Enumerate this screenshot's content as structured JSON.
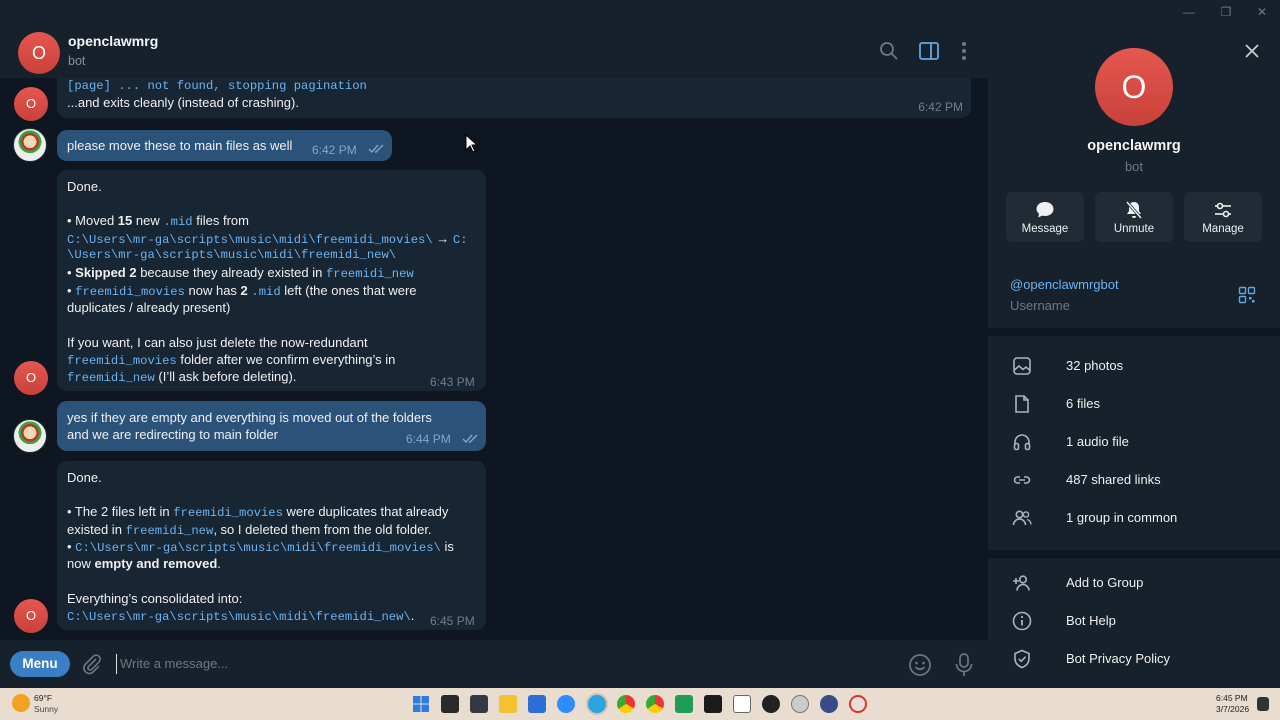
{
  "window": {
    "minimize": "—",
    "maximize": "❐",
    "close": "✕"
  },
  "header": {
    "avatar_letter": "O",
    "name": "openclawmrg",
    "status": "bot"
  },
  "messages": {
    "m1": {
      "line1": "[page] ... not found, stopping pagination",
      "line2": "...and exits cleanly (instead of crashing).",
      "time": "6:42 PM",
      "avatar": "O"
    },
    "m2": {
      "text": "please move these to main files as well",
      "time": "6:42 PM"
    },
    "m3": {
      "done": "Done.",
      "b1_pre": "• Moved ",
      "b1_num": "15",
      "b1_mid": " new ",
      "b1_code": ".mid",
      "b1_post": " files from",
      "path1": "C:\\Users\\mr-ga\\scripts\\music\\midi\\freemidi_movies\\",
      "arrow": " → ",
      "path2a": "C:",
      "path2b": "\\Users\\mr-ga\\scripts\\music\\midi\\freemidi_new\\",
      "b2_pre": "• ",
      "b2_bold": "Skipped 2",
      "b2_mid": " because they already existed in ",
      "b2_code": "freemidi_new",
      "b3_pre": "• ",
      "b3_code": "freemidi_movies",
      "b3_mid": " now has ",
      "b3_num": "2",
      "b3_sp": " ",
      "b3_code2": ".mid",
      "b3_post": " left (the ones that were",
      "b3_line2": "duplicates / already present)",
      "p1": "If you want, I can also just delete the now-redundant",
      "p2_code": "freemidi_movies",
      "p2_post": " folder after we confirm everything’s in",
      "p3_code": "freemidi_new",
      "p3_post": " (I’ll ask before deleting).",
      "time": "6:43 PM",
      "avatar": "O"
    },
    "m4": {
      "line1": "yes if they are empty and everything is moved out of the folders",
      "line2": "and we are redirecting to main folder",
      "time": "6:44 PM"
    },
    "m5": {
      "done": "Done.",
      "l1_pre": "• The 2 files left in ",
      "l1_code": "freemidi_movies",
      "l1_post": " were duplicates that already",
      "l2_pre": "existed in ",
      "l2_code": "freemidi_new",
      "l2_post": ", so I deleted them from the old folder.",
      "l3_pre": "• ",
      "l3_code": "C:\\Users\\mr-ga\\scripts\\music\\midi\\freemidi_movies\\",
      "l3_post": " is",
      "l4_pre": "now ",
      "l4_bold": "empty and removed",
      "l4_post": ".",
      "l5": "Everything’s consolidated into:",
      "l6_code": "C:\\Users\\mr-ga\\scripts\\music\\midi\\freemidi_new\\",
      "l6_post": ".",
      "time": "6:45 PM",
      "avatar": "O"
    }
  },
  "composer": {
    "menu": "Menu",
    "placeholder": "Write a message..."
  },
  "panel": {
    "avatar_letter": "O",
    "name": "openclawmrg",
    "status": "bot",
    "actions": [
      {
        "label": "Message"
      },
      {
        "label": "Unmute"
      },
      {
        "label": "Manage"
      }
    ],
    "username": "@openclawmrgbot",
    "username_label": "Username",
    "media": [
      {
        "label": "32 photos"
      },
      {
        "label": "6 files"
      },
      {
        "label": "1 audio file"
      },
      {
        "label": "487 shared links"
      },
      {
        "label": "1 group in common"
      }
    ],
    "links": [
      {
        "label": "Add to Group"
      },
      {
        "label": "Bot Help"
      },
      {
        "label": "Bot Privacy Policy"
      }
    ]
  },
  "taskbar": {
    "temp": "69°F",
    "weather": "Sunny",
    "time": "6:45 PM",
    "date": "3/7/2026"
  },
  "colors": {
    "accent": "#6ab3f3",
    "bot_avatar": "#e5574f",
    "outgoing": "#2b5278",
    "incoming": "#182533"
  }
}
